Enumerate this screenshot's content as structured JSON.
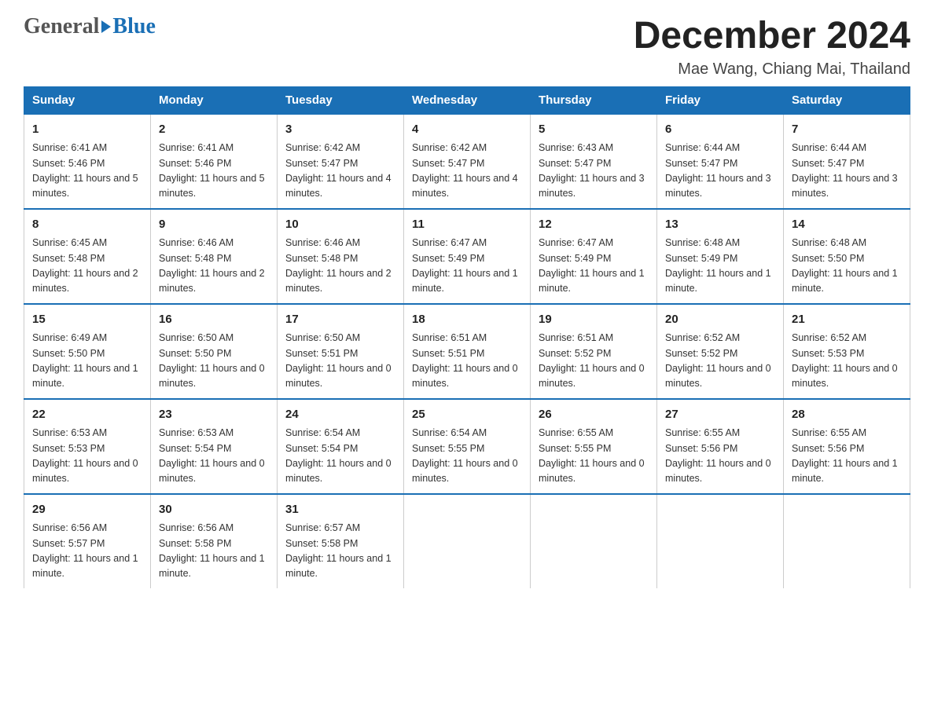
{
  "header": {
    "logo_general": "General",
    "logo_blue": "Blue",
    "main_title": "December 2024",
    "subtitle": "Mae Wang, Chiang Mai, Thailand"
  },
  "calendar": {
    "days_of_week": [
      "Sunday",
      "Monday",
      "Tuesday",
      "Wednesday",
      "Thursday",
      "Friday",
      "Saturday"
    ],
    "weeks": [
      [
        {
          "day": "1",
          "sunrise": "6:41 AM",
          "sunset": "5:46 PM",
          "daylight": "11 hours and 5 minutes."
        },
        {
          "day": "2",
          "sunrise": "6:41 AM",
          "sunset": "5:46 PM",
          "daylight": "11 hours and 5 minutes."
        },
        {
          "day": "3",
          "sunrise": "6:42 AM",
          "sunset": "5:47 PM",
          "daylight": "11 hours and 4 minutes."
        },
        {
          "day": "4",
          "sunrise": "6:42 AM",
          "sunset": "5:47 PM",
          "daylight": "11 hours and 4 minutes."
        },
        {
          "day": "5",
          "sunrise": "6:43 AM",
          "sunset": "5:47 PM",
          "daylight": "11 hours and 3 minutes."
        },
        {
          "day": "6",
          "sunrise": "6:44 AM",
          "sunset": "5:47 PM",
          "daylight": "11 hours and 3 minutes."
        },
        {
          "day": "7",
          "sunrise": "6:44 AM",
          "sunset": "5:47 PM",
          "daylight": "11 hours and 3 minutes."
        }
      ],
      [
        {
          "day": "8",
          "sunrise": "6:45 AM",
          "sunset": "5:48 PM",
          "daylight": "11 hours and 2 minutes."
        },
        {
          "day": "9",
          "sunrise": "6:46 AM",
          "sunset": "5:48 PM",
          "daylight": "11 hours and 2 minutes."
        },
        {
          "day": "10",
          "sunrise": "6:46 AM",
          "sunset": "5:48 PM",
          "daylight": "11 hours and 2 minutes."
        },
        {
          "day": "11",
          "sunrise": "6:47 AM",
          "sunset": "5:49 PM",
          "daylight": "11 hours and 1 minute."
        },
        {
          "day": "12",
          "sunrise": "6:47 AM",
          "sunset": "5:49 PM",
          "daylight": "11 hours and 1 minute."
        },
        {
          "day": "13",
          "sunrise": "6:48 AM",
          "sunset": "5:49 PM",
          "daylight": "11 hours and 1 minute."
        },
        {
          "day": "14",
          "sunrise": "6:48 AM",
          "sunset": "5:50 PM",
          "daylight": "11 hours and 1 minute."
        }
      ],
      [
        {
          "day": "15",
          "sunrise": "6:49 AM",
          "sunset": "5:50 PM",
          "daylight": "11 hours and 1 minute."
        },
        {
          "day": "16",
          "sunrise": "6:50 AM",
          "sunset": "5:50 PM",
          "daylight": "11 hours and 0 minutes."
        },
        {
          "day": "17",
          "sunrise": "6:50 AM",
          "sunset": "5:51 PM",
          "daylight": "11 hours and 0 minutes."
        },
        {
          "day": "18",
          "sunrise": "6:51 AM",
          "sunset": "5:51 PM",
          "daylight": "11 hours and 0 minutes."
        },
        {
          "day": "19",
          "sunrise": "6:51 AM",
          "sunset": "5:52 PM",
          "daylight": "11 hours and 0 minutes."
        },
        {
          "day": "20",
          "sunrise": "6:52 AM",
          "sunset": "5:52 PM",
          "daylight": "11 hours and 0 minutes."
        },
        {
          "day": "21",
          "sunrise": "6:52 AM",
          "sunset": "5:53 PM",
          "daylight": "11 hours and 0 minutes."
        }
      ],
      [
        {
          "day": "22",
          "sunrise": "6:53 AM",
          "sunset": "5:53 PM",
          "daylight": "11 hours and 0 minutes."
        },
        {
          "day": "23",
          "sunrise": "6:53 AM",
          "sunset": "5:54 PM",
          "daylight": "11 hours and 0 minutes."
        },
        {
          "day": "24",
          "sunrise": "6:54 AM",
          "sunset": "5:54 PM",
          "daylight": "11 hours and 0 minutes."
        },
        {
          "day": "25",
          "sunrise": "6:54 AM",
          "sunset": "5:55 PM",
          "daylight": "11 hours and 0 minutes."
        },
        {
          "day": "26",
          "sunrise": "6:55 AM",
          "sunset": "5:55 PM",
          "daylight": "11 hours and 0 minutes."
        },
        {
          "day": "27",
          "sunrise": "6:55 AM",
          "sunset": "5:56 PM",
          "daylight": "11 hours and 0 minutes."
        },
        {
          "day": "28",
          "sunrise": "6:55 AM",
          "sunset": "5:56 PM",
          "daylight": "11 hours and 1 minute."
        }
      ],
      [
        {
          "day": "29",
          "sunrise": "6:56 AM",
          "sunset": "5:57 PM",
          "daylight": "11 hours and 1 minute."
        },
        {
          "day": "30",
          "sunrise": "6:56 AM",
          "sunset": "5:58 PM",
          "daylight": "11 hours and 1 minute."
        },
        {
          "day": "31",
          "sunrise": "6:57 AM",
          "sunset": "5:58 PM",
          "daylight": "11 hours and 1 minute."
        },
        null,
        null,
        null,
        null
      ]
    ]
  }
}
